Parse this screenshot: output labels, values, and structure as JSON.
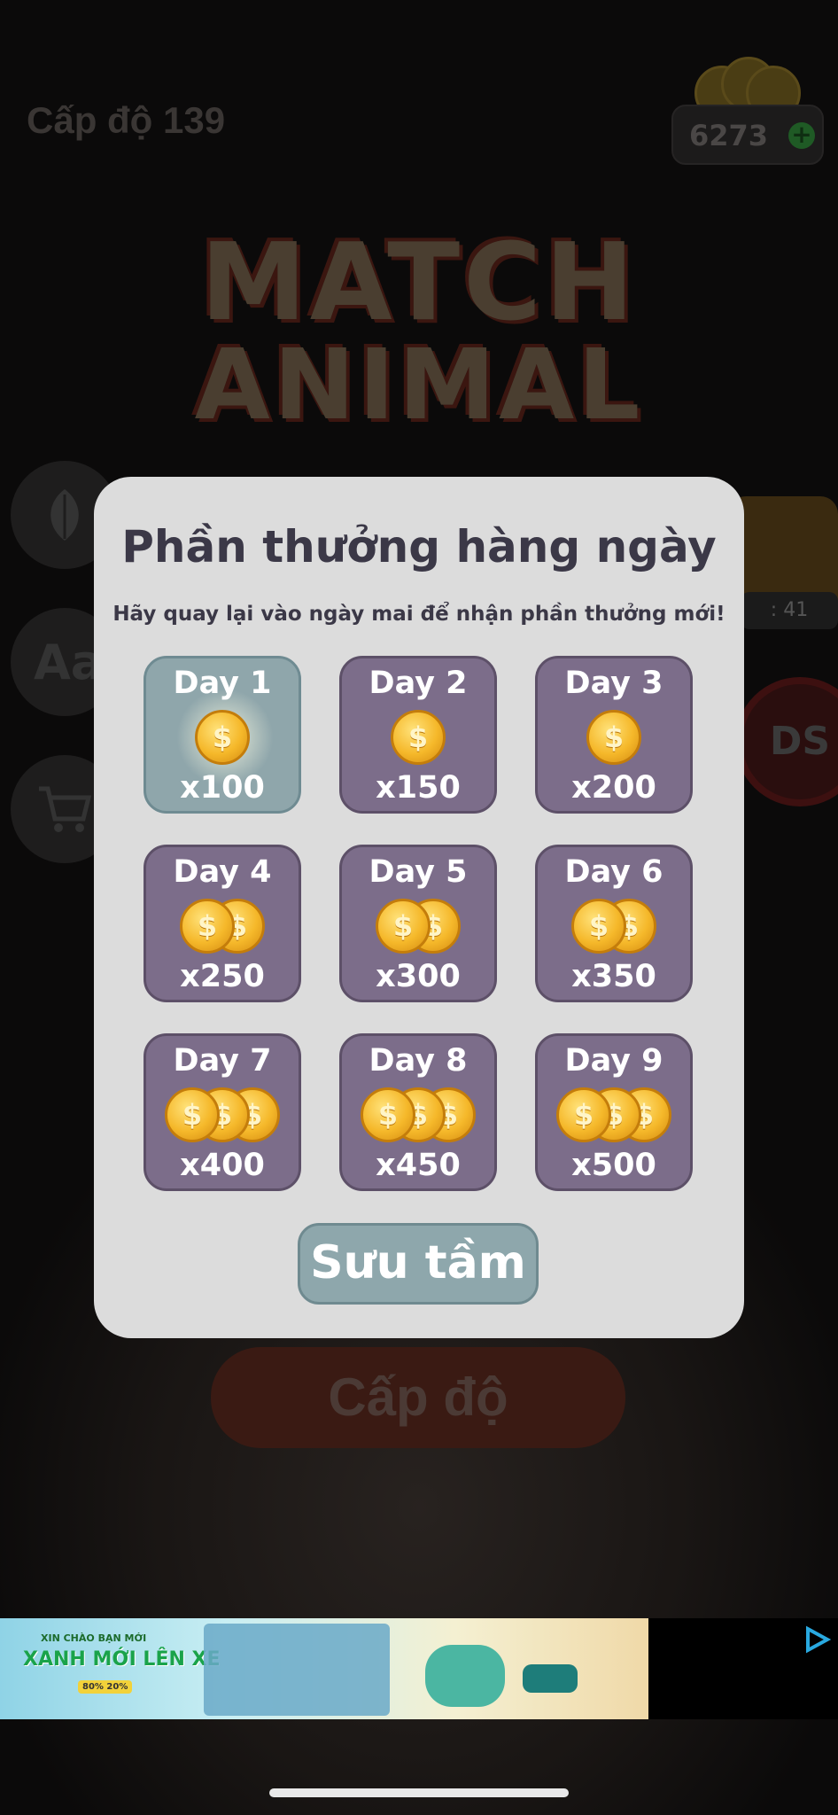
{
  "header": {
    "level_label": "Cấp độ 139",
    "coin_count": "6273",
    "coin_plus": "+"
  },
  "game_title": {
    "line1": "MATCH",
    "line2": "ANIMAL"
  },
  "side_buttons": [
    {
      "icon": "leaf-icon"
    },
    {
      "icon": "font-size-icon",
      "text": "Aa"
    },
    {
      "icon": "cart-icon"
    }
  ],
  "gift_timer": ": 41",
  "no_ads_label": "DS",
  "level_button": "Cấp độ",
  "daily_reward": {
    "title": "Phần thưởng hàng ngày",
    "subtitle": "Hãy quay lại vào ngày mai để nhận phần thưởng mới!",
    "days": [
      {
        "label": "Day 1",
        "amount": "x100",
        "coins": 1,
        "claimed": true
      },
      {
        "label": "Day 2",
        "amount": "x150",
        "coins": 1,
        "claimed": false
      },
      {
        "label": "Day 3",
        "amount": "x200",
        "coins": 1,
        "claimed": false
      },
      {
        "label": "Day 4",
        "amount": "x250",
        "coins": 2,
        "claimed": false
      },
      {
        "label": "Day 5",
        "amount": "x300",
        "coins": 2,
        "claimed": false
      },
      {
        "label": "Day 6",
        "amount": "x350",
        "coins": 2,
        "claimed": false
      },
      {
        "label": "Day 7",
        "amount": "x400",
        "coins": 3,
        "claimed": false
      },
      {
        "label": "Day 8",
        "amount": "x450",
        "coins": 3,
        "claimed": false
      },
      {
        "label": "Day 9",
        "amount": "x500",
        "coins": 3,
        "claimed": false
      }
    ],
    "collect_label": "Sưu tầm",
    "coin_symbol": "$"
  },
  "ad": {
    "line1": "XIN CHÀO BẠN MỚI",
    "line2": "XANH MỚI LÊN XE",
    "line3": "80% 20%"
  },
  "colors": {
    "modal_bg": "#dcdcdc",
    "day_card": "#7c6d8a",
    "day_claimed": "#8fa6ab",
    "title_text": "#3b3847"
  }
}
